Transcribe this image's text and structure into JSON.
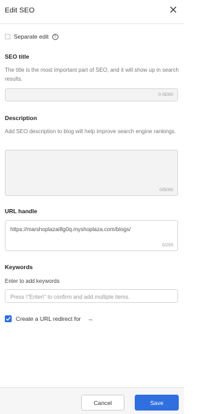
{
  "header": {
    "title": "Edit SEO",
    "close_icon": "close-icon"
  },
  "separate_edit": {
    "label": "Separate edit",
    "checked": false,
    "help_icon": "?"
  },
  "seo_title": {
    "label": "SEO title",
    "description": "The title is the most important part of SEO, and it will show up in search results.",
    "value": "",
    "counter": "0 /5000"
  },
  "description": {
    "label": "Description",
    "help": "Add SEO description to blog will help improve search engine rankings.",
    "value": "",
    "counter": "0/5000"
  },
  "url_handle": {
    "label": "URL handle",
    "value": "https://marshoplazai8g0q.myshoplaza.com/blogs/",
    "counter": "0/255"
  },
  "keywords": {
    "label": "Keywords",
    "help": "Enter to add keywords",
    "placeholder": "Press \\\"Enter\\\" to confirm and add multiple items."
  },
  "redirect": {
    "label": "Create a URL redirect for",
    "arrow": "→",
    "checked": true
  },
  "footer": {
    "cancel_label": "Cancel",
    "save_label": "Save"
  },
  "colors": {
    "accent": "#2f6fe0",
    "muted_text": "#7a7a7a",
    "border": "#d7d7d7"
  }
}
